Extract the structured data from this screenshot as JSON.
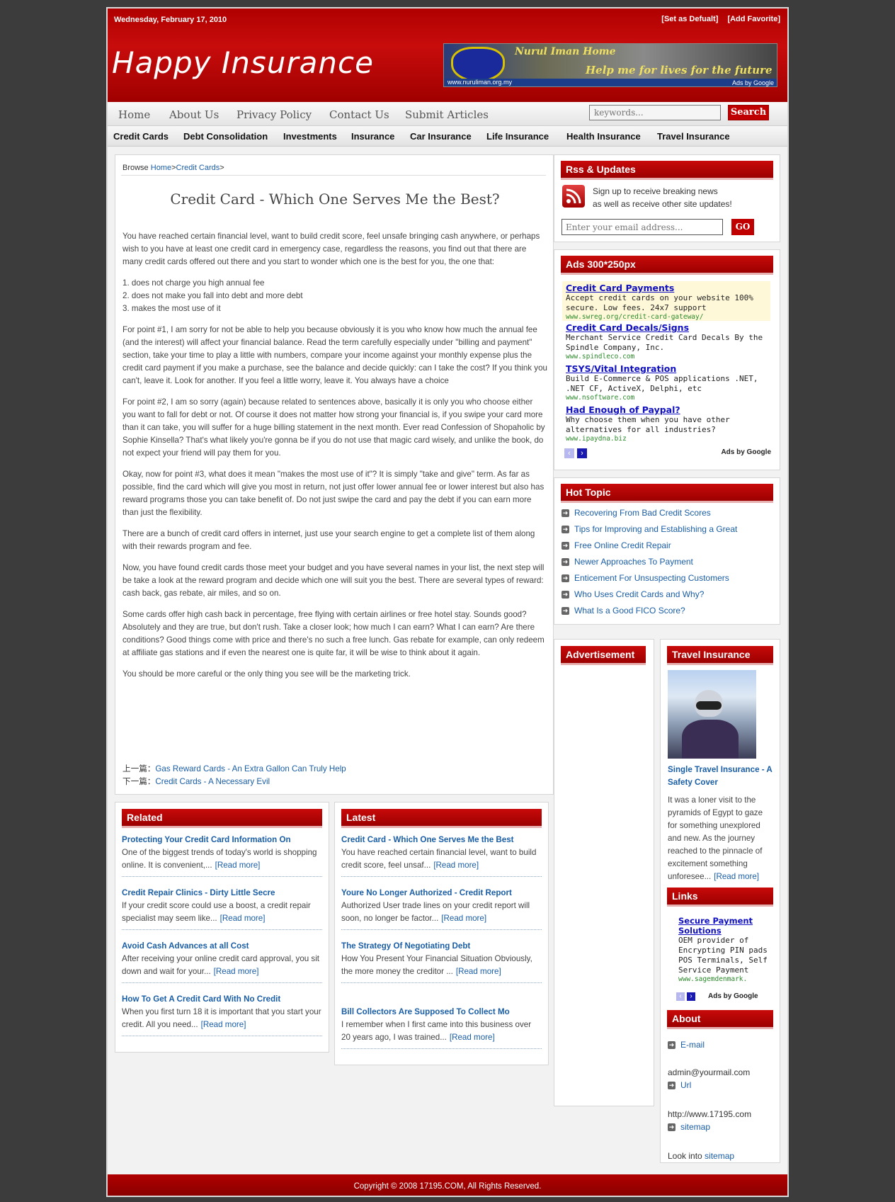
{
  "header": {
    "date": "Wednesday, February 17, 2010",
    "set_default": "[Set as Defualt]",
    "add_favorite": "[Add Favorite]",
    "logo": "Happy Insurance",
    "banner": {
      "line1": "Nurul Iman Home",
      "line2": "Help me for lives for the future",
      "url": "www.nuruliman.org.my",
      "ads": "Ads by Google"
    }
  },
  "nav_main": [
    "Home",
    "About Us",
    "Privacy Policy",
    "Contact Us",
    "Submit Articles"
  ],
  "search": {
    "placeholder": "keywords...",
    "button": "Search"
  },
  "nav_categories": [
    "Credit Cards",
    "Debt Consolidation",
    "Investments",
    "Insurance",
    "Car Insurance",
    "Life Insurance",
    "Health Insurance",
    "Travel Insurance"
  ],
  "breadcrumb": {
    "prefix": "Browse ",
    "home": "Home",
    "sep1": ">",
    "category": "Credit Cards",
    "sep2": ">"
  },
  "article": {
    "title": "Credit Card - Which One Serves Me the Best?",
    "p1": "You have reached certain financial level, want to build credit score, feel unsafe bringing cash anywhere, or perhaps wish to you have at least one credit card in emergency case, regardless the reasons, you find out that there are many credit cards offered out there and you start to wonder which one is the best for you, the one that:",
    "li1": "1. does not charge you high annual fee",
    "li2": "2. does not make you fall into debt and more debt",
    "li3": "3. makes the most use of it",
    "p2": "For point #1, I am sorry for not be able to help you because obviously it is you who know how much the annual fee (and the interest) will affect your financial balance. Read the term carefully especially under \"billing and payment\" section, take your time to play a little with numbers, compare your income against your monthly expense plus the credit card payment if you make a purchase, see the balance and decide quickly: can I take the cost? If you think you can't, leave it. Look for another. If you feel a little worry, leave it. You always have a choice",
    "p3": "For point #2, I am so sorry (again) because related to sentences above, basically it is only you who choose either you want to fall for debt or not. Of course it does not matter how strong your financial is, if you swipe your card more than it can take, you will suffer for a huge billing statement in the next month. Ever read Confession of Shopaholic by Sophie Kinsella? That's what likely you're gonna be if you do not use that magic card wisely, and unlike the book, do not expect your friend will pay them for you.",
    "p4": "Okay, now for point #3, what does it mean \"makes the most use of it\"? It is simply \"take and give\" term. As far as possible, find the card which will give you most in return, not just offer lower annual fee or lower interest but also has reward programs those you can take benefit of. Do not just swipe the card and pay the debt if you can earn more than just the flexibility.",
    "p5": "There are a bunch of credit card offers in internet, just use your search engine to get a complete list of them along with their rewards program and fee.",
    "p6": "Now, you have found credit cards those meet your budget and you have several names in your list, the next step will be take a look at the reward program and decide which one will suit you the best. There are several types of reward: cash back, gas rebate, air miles, and so on.",
    "p7": "Some cards offer high cash back in percentage, free flying with certain airlines or free hotel stay. Sounds good? Absolutely and they are true, but don't rush. Take a closer look; how much I can earn? What I can earn? Are there conditions? Good things come with price and there's no such a free lunch. Gas rebate for example, can only redeem at affiliate gas stations and if even the nearest one is quite far, it will be wise to think about it again.",
    "p8": "You should be more careful or the only thing you see will be the marketing trick.",
    "prev_label": "上一篇：",
    "prev_link": "Gas Reward Cards - An Extra Gallon Can Truly Help",
    "next_label": "下一篇：",
    "next_link": "Credit Cards - A Necessary Evil"
  },
  "related": {
    "heading": "Related",
    "read_more": "[Read more]",
    "items": [
      {
        "title": "Protecting Your Credit Card Information On",
        "desc": "One of the biggest trends of today's world is shopping online. It is convenient,..."
      },
      {
        "title": "Credit Repair Clinics - Dirty Little Secre",
        "desc": "If your credit score could use a boost, a credit repair specialist may seem like..."
      },
      {
        "title": "Avoid Cash Advances at all Cost",
        "desc": "After receiving your online credit card approval, you sit down and wait for your..."
      },
      {
        "title": "How To Get A Credit Card With No Credit",
        "desc": "When you first turn 18 it is important that you start your credit. All you need..."
      }
    ]
  },
  "latest": {
    "heading": "Latest",
    "read_more": "[Read more]",
    "items": [
      {
        "title": "Credit Card - Which One Serves Me the Best",
        "desc": "You have reached certain financial level, want to build credit score, feel unsaf..."
      },
      {
        "title": "Youre No Longer Authorized - Credit Report",
        "desc": "Authorized User trade lines on your credit report will soon, no longer be factor..."
      },
      {
        "title": "The Strategy Of Negotiating Debt",
        "desc": "How You Present Your Financial Situation Obviously, the more money the creditor ..."
      },
      {
        "title": "Bill Collectors Are Supposed To Collect Mo",
        "desc": "I remember when I first came into this business over 20 years ago, I was trained..."
      }
    ]
  },
  "rss": {
    "heading": "Rss & Updates",
    "line1": "Sign up to receive breaking news",
    "line2": "as well as receive other site updates!",
    "email_placeholder": "Enter your email address...",
    "go": "GO"
  },
  "ads": {
    "heading": "Ads 300*250px",
    "items": [
      {
        "title": "Credit Card Payments",
        "desc": "Accept credit cards on your website 100% secure. Low fees. 24x7 support",
        "url": "www.swreg.org/credit-card-gateway/"
      },
      {
        "title": "Credit Card Decals/Signs",
        "desc": "Merchant Service Credit Card Decals By the Spindle Company, Inc.",
        "url": "www.spindleco.com"
      },
      {
        "title": "TSYS/Vital Integration",
        "desc": "Build E-Commerce & POS applications .NET, .NET CF, ActiveX, Delphi, etc",
        "url": "www.nsoftware.com"
      },
      {
        "title": "Had Enough of Paypal?",
        "desc": "Why choose them when you have other alternatives for all industries?",
        "url": "www.ipaydna.biz"
      }
    ],
    "ads_by": "Ads by Google"
  },
  "hot_topic": {
    "heading": "Hot Topic",
    "items": [
      "Recovering From Bad Credit Scores",
      "Tips for Improving and Establishing a Great",
      "Free Online Credit Repair",
      "Newer Approaches To Payment",
      "Enticement For Unsuspecting Customers",
      "Who Uses Credit Cards and Why?",
      "What Is a Good FICO Score?"
    ]
  },
  "advertisement": {
    "heading": "Advertisement"
  },
  "travel": {
    "heading": "Travel Insurance",
    "title": "Single Travel Insurance - A Safety Cover",
    "desc": "It was a loner visit to the pyramids of Egypt to gaze for something unexplored and new. As the journey reached to the pinnacle of excitement something unforesee...",
    "read_more": "[Read more]"
  },
  "links": {
    "heading": "Links",
    "ad_title": "Secure Payment Solutions",
    "ad_desc": "OEM provider of Encrypting PIN pads POS Terminals, Self Service Payment",
    "ad_url": "www.sagemdenmark.",
    "ads_by": "Ads by Google"
  },
  "about": {
    "heading": "About",
    "email_label": "E-mail",
    "email": "admin@yourmail.com",
    "url_label": "Url",
    "url": "http://www.17195.com",
    "sitemap_label": "sitemap",
    "look_into": "Look into ",
    "look_link": "sitemap"
  },
  "footer": "Copyright © 2008 17195.COM, All Rights Reserved."
}
